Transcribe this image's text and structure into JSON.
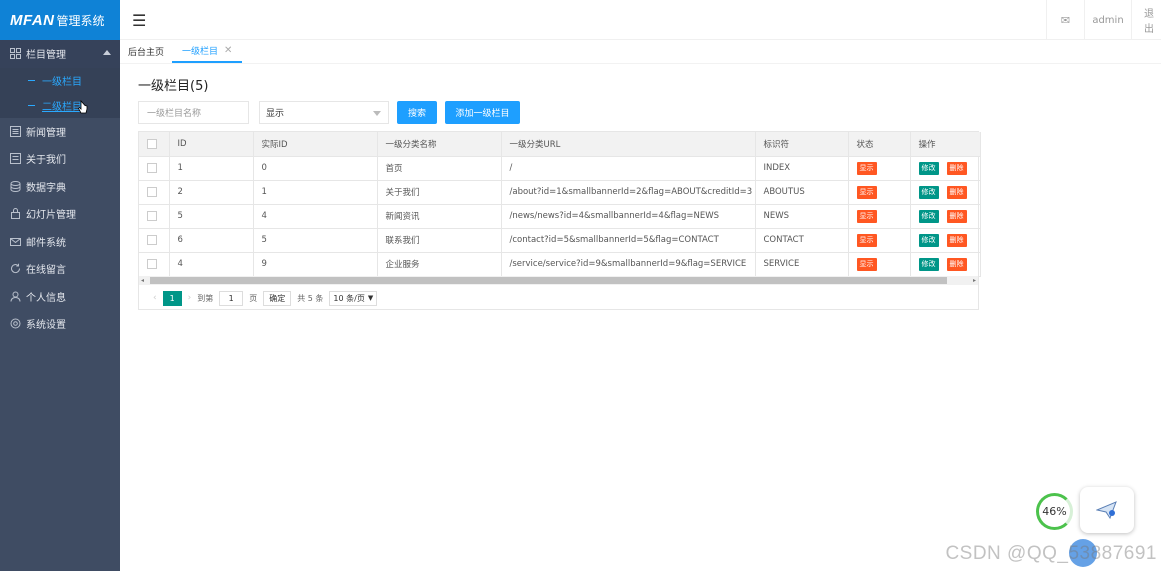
{
  "app": {
    "brand": "MFAN",
    "system": "管理系统"
  },
  "sidebar": {
    "items": [
      {
        "label": "栏目管理",
        "icon": "grid-icon",
        "open": true,
        "children": [
          {
            "label": "一级栏目"
          },
          {
            "label": "二级栏目"
          }
        ]
      },
      {
        "label": "新闻管理",
        "icon": "news-icon"
      },
      {
        "label": "关于我们",
        "icon": "document-icon"
      },
      {
        "label": "数据字典",
        "icon": "database-icon"
      },
      {
        "label": "幻灯片管理",
        "icon": "lock-icon"
      },
      {
        "label": "邮件系统",
        "icon": "mail-icon"
      },
      {
        "label": "在线留言",
        "icon": "refresh-icon"
      },
      {
        "label": "个人信息",
        "icon": "user-icon"
      },
      {
        "label": "系统设置",
        "icon": "settings-icon"
      }
    ]
  },
  "header": {
    "menu_icon": "☰",
    "mail_icon": "✉",
    "user": "admin",
    "logout": "退出"
  },
  "tabs": [
    {
      "label": "后台主页"
    },
    {
      "label": "一级栏目",
      "close": "✕"
    }
  ],
  "page": {
    "title": "一级栏目(5)"
  },
  "toolbar": {
    "search_placeholder": "一级栏目名称",
    "select_value": "显示",
    "search_label": "搜索",
    "add_label": "添加一级栏目"
  },
  "table": {
    "columns": [
      "ID",
      "实际ID",
      "一级分类名称",
      "一级分类URL",
      "标识符",
      "状态",
      "操作"
    ],
    "rows": [
      {
        "id": "1",
        "real_id": "0",
        "name": "首页",
        "url": "/",
        "flag": "INDEX"
      },
      {
        "id": "2",
        "real_id": "1",
        "name": "关于我们",
        "url": "/about?id=1&smallbannerId=2&flag=ABOUT&creditId=3",
        "flag": "ABOUTUS"
      },
      {
        "id": "5",
        "real_id": "4",
        "name": "新闻资讯",
        "url": "/news/news?id=4&smallbannerId=4&flag=NEWS",
        "flag": "NEWS"
      },
      {
        "id": "6",
        "real_id": "5",
        "name": "联系我们",
        "url": "/contact?id=5&smallbannerId=5&flag=CONTACT",
        "flag": "CONTACT"
      },
      {
        "id": "4",
        "real_id": "9",
        "name": "企业服务",
        "url": "/service/service?id=9&smallbannerId=9&flag=SERVICE",
        "flag": "SERVICE"
      }
    ],
    "status_label": "显示",
    "edit_label": "修改",
    "delete_label": "删除"
  },
  "pagination": {
    "current": "1",
    "goto_label": "到第",
    "goto_value": "1",
    "page_unit": "页",
    "confirm_label": "确定",
    "total_label": "共 5 条",
    "page_size": "10 条/页"
  },
  "overlay": {
    "progress": "46%",
    "watermark": "CSDN @QQ_53887691"
  },
  "colors": {
    "sidebar": "#3f4c63",
    "brand": "#0f82d6",
    "primary": "#1e9fff",
    "danger": "#ff5722",
    "success": "#009688"
  }
}
